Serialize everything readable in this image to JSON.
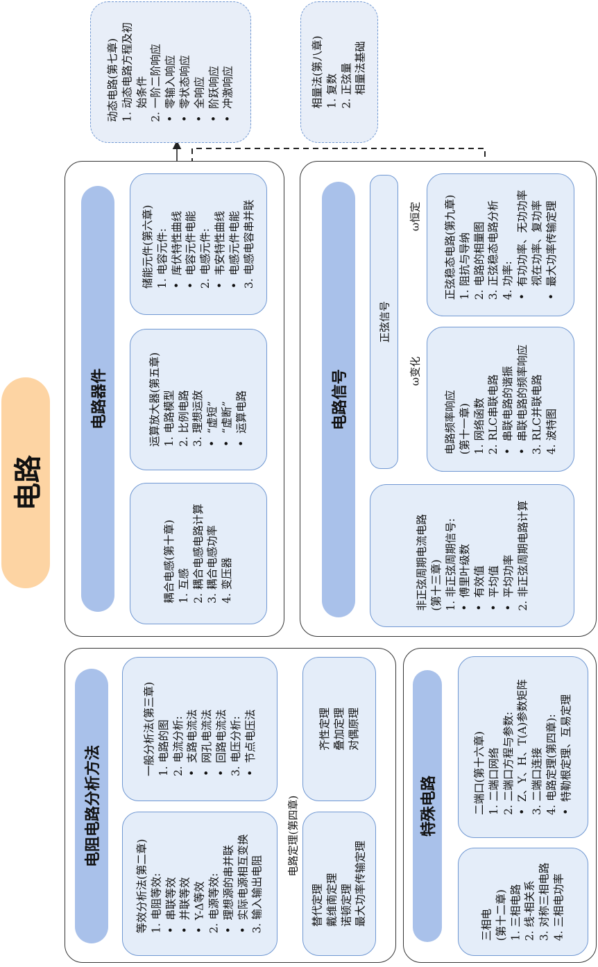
{
  "root": {
    "label": "电路"
  },
  "components": {
    "title": "电路器件",
    "coupled": {
      "text": "耦合电感(第十章)\n1. 互感\n2. 耦合电感电路计算\n3. 耦合电感功率\n4. 变压器"
    },
    "opamp": {
      "text": "运算放大器(第五章)\n1. 电路模型\n2. 比例电路\n3. 理想运放\n•  “虚短”\n•  “虚断”\n•  运算电路"
    },
    "storage": {
      "text": "储能元件(第六章)\n1. 电容元件:\n•  库伏特性曲线\n•  电容元件电能\n2. 电感元件:\n•  韦安特性曲线\n•  电感元件电能\n3. 电感电容串并联"
    }
  },
  "dynamic": {
    "text": "动态电路(第七章)\n1. 动态电路方程及初\n    始条件\n2. 一阶二阶响应\n•  零输入响应\n•  零状态响应\n•  全响应\n•  阶跃响应\n•  冲激响应"
  },
  "phasor": {
    "text": "相量法(第八章)\n1. 复数\n2. 正弦量\n    相量法基础"
  },
  "signals": {
    "title": "电路信号",
    "sinusoidal_label": "正弦信号",
    "nonsin": {
      "text": "非正弦周期电流电路\n(第十三章)\n1. 非正弦周期信号:\n•  傅里叶级数\n•  有效值\n•  平均值\n•  平均功率\n2. 非正弦周期电路计算"
    },
    "omega_var": "ω变化",
    "omega_const": "ω恒定",
    "freq": {
      "text": "电路频率响应\n(第十一章)\n1. 网络函数\n2. RLC串联电路\n•  串联电路的谐振\n•  串联电路的频率响应\n3. RLC并联电路\n4. 波特图"
    },
    "steady": {
      "text": "正弦稳态电路(第九章)\n1. 阻抗与导纳\n2. 电路的相量图\n3. 正弦稳态电路分析\n4. 功率:\n•  有功功率、无功功率\n    视在功率、复功率\n•  最大功率传输定理"
    }
  },
  "resistive": {
    "title": "电阻电路分析方法",
    "equiv": {
      "text": "等效分析法(第二章)\n1. 电阻等效:\n•  串联等效\n•  并联等效\n•  Y-Δ等效\n2. 电源等效:\n•  理想源的串并联\n•  实际电源相互变换\n3. 输入输出电阻"
    },
    "general": {
      "text": "一般分析法(第三章)\n1. 电路的图\n2. 电流分析:\n•  支路电流法\n•  网孔电流法\n•  回路电流法\n3. 电压分析:\n•  节点电压法"
    },
    "theorems_label": "电路定理(第四章)",
    "theorems1": {
      "text": "替代定理\n戴维南定理\n诺顿定理\n最大功率传输定理"
    },
    "theorems2": {
      "text": "齐性定理\n叠加定理\n对偶原理"
    }
  },
  "special": {
    "title": "特殊电路",
    "threephase": {
      "text": "三相电\n(第十二章)\n1. 三相电路\n2. 线-相关系\n3. 对称三相电路\n4. 三相电功率"
    },
    "twoport": {
      "text": "二端口(第十六章)\n1. 二端口网络\n2. 二端口方程与参数:\n•  Z、Y、H、T(A)参数矩阵\n3. 二端口连接\n4. 电路定理(第四章):\n•  特勒根定理、互易定理"
    }
  }
}
